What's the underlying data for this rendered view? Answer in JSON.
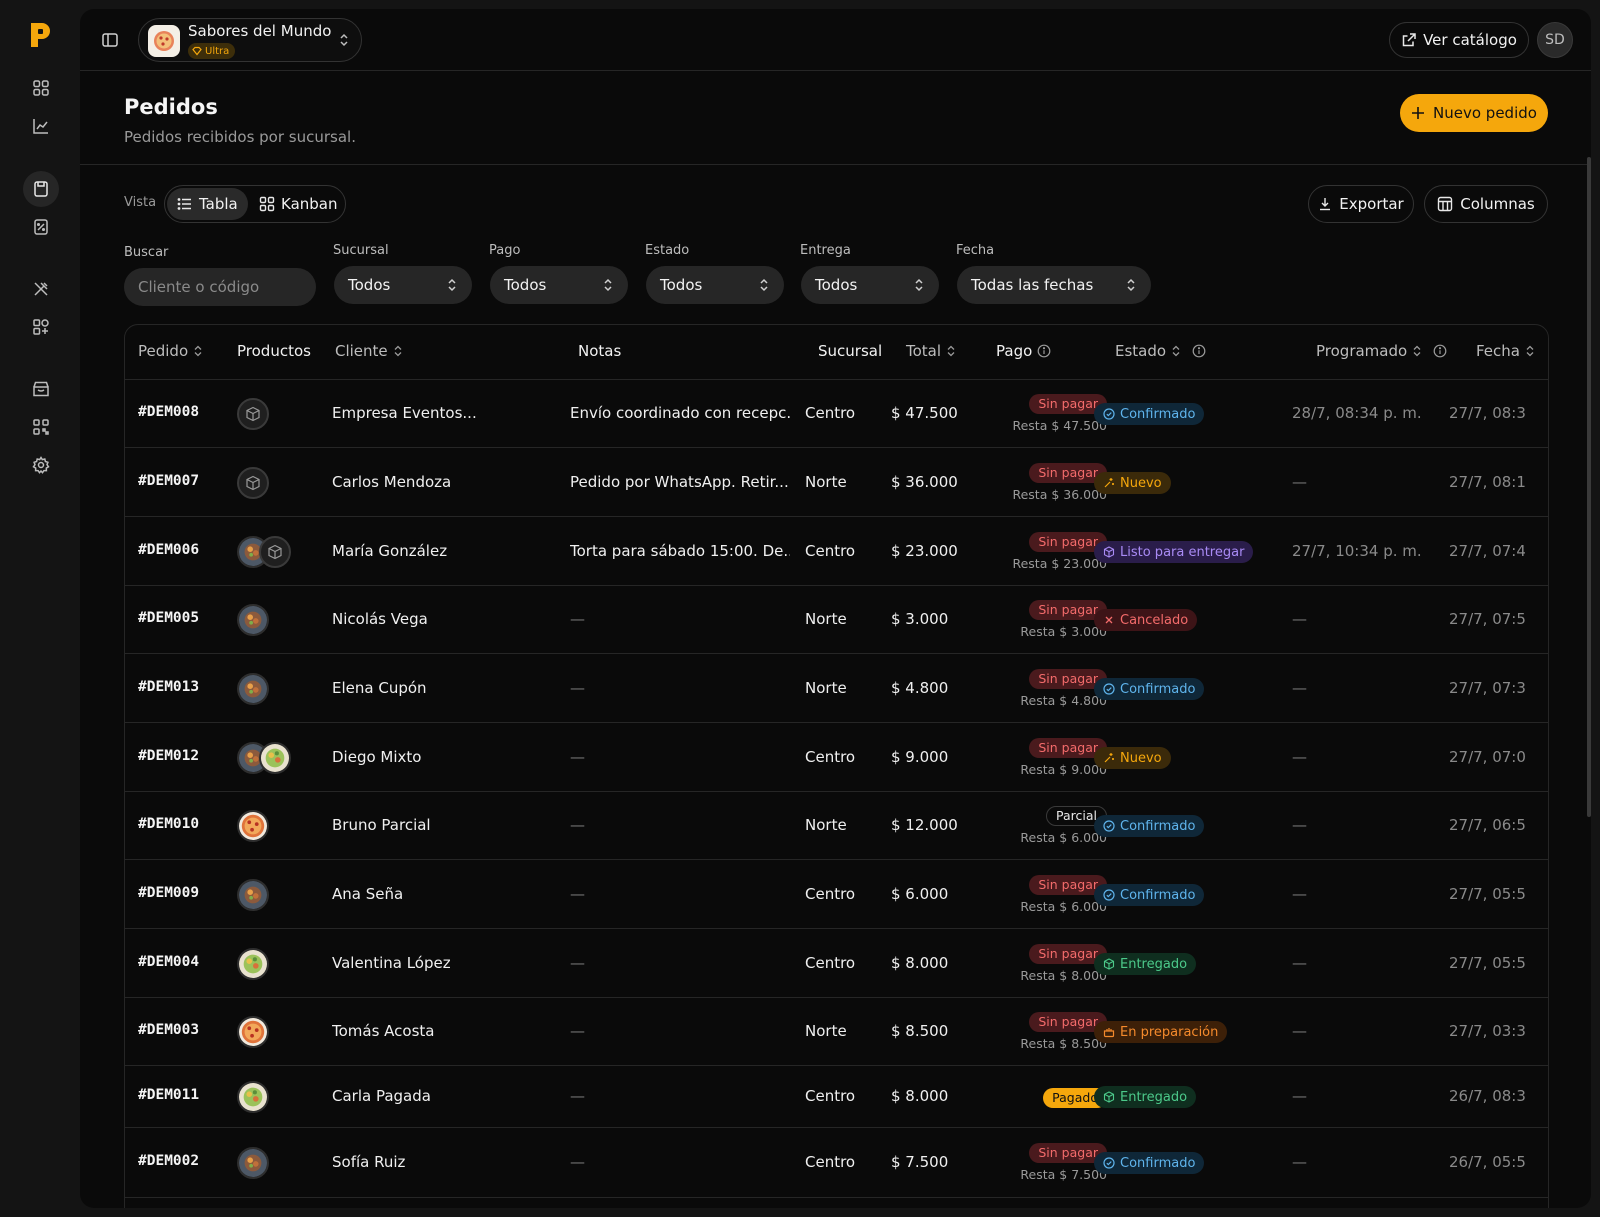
{
  "store": {
    "name": "Sabores del Mundo",
    "plan": "Ultra"
  },
  "topbar": {
    "catalog_label": "Ver catálogo",
    "avatar_initials": "SD"
  },
  "header": {
    "title": "Pedidos",
    "subtitle": "Pedidos recibidos por sucursal.",
    "new_order_label": "Nuevo pedido"
  },
  "view": {
    "label": "Vista",
    "options": [
      "Tabla",
      "Kanban"
    ],
    "selected": "Tabla"
  },
  "actions": {
    "export_label": "Exportar",
    "columns_label": "Columnas"
  },
  "filters": {
    "search": {
      "label": "Buscar",
      "placeholder": "Cliente o código"
    },
    "sucursal": {
      "label": "Sucursal",
      "value": "Todos"
    },
    "pago": {
      "label": "Pago",
      "value": "Todos"
    },
    "estado": {
      "label": "Estado",
      "value": "Todos"
    },
    "entrega": {
      "label": "Entrega",
      "value": "Todos"
    },
    "fecha": {
      "label": "Fecha",
      "value": "Todas las fechas"
    }
  },
  "table": {
    "columns": [
      "Pedido",
      "Productos",
      "Cliente",
      "Notas",
      "Sucursal",
      "Total",
      "Pago",
      "Estado",
      "Programado",
      "Fecha"
    ],
    "rows": [
      {
        "id": "#DEM008",
        "products": [
          "box"
        ],
        "client": "Empresa Eventos...",
        "notes": "Envío coordinado con recepc...",
        "branch": "Centro",
        "total": "$ 47.500",
        "pay": "Sin pagar",
        "pay_kind": "sinpagar",
        "rest": "Resta $ 47.500",
        "status": "Confirmado",
        "status_kind": "confirmado",
        "scheduled": "28/7, 08:34 p. m.",
        "date": "27/7, 08:3"
      },
      {
        "id": "#DEM007",
        "products": [
          "box"
        ],
        "client": "Carlos Mendoza",
        "notes": "Pedido por WhatsApp. Retir...",
        "branch": "Norte",
        "total": "$ 36.000",
        "pay": "Sin pagar",
        "pay_kind": "sinpagar",
        "rest": "Resta $ 36.000",
        "status": "Nuevo",
        "status_kind": "nuevo",
        "scheduled": "—",
        "date": "27/7, 08:1"
      },
      {
        "id": "#DEM006",
        "products": [
          "bowl",
          "box"
        ],
        "client": "María González",
        "notes": "Torta para sábado 15:00. De...",
        "branch": "Centro",
        "total": "$ 23.000",
        "pay": "Sin pagar",
        "pay_kind": "sinpagar",
        "rest": "Resta $ 23.000",
        "status": "Listo para entregar",
        "status_kind": "listo",
        "scheduled": "27/7, 10:34 p. m.",
        "date": "27/7, 07:4"
      },
      {
        "id": "#DEM005",
        "products": [
          "bowl"
        ],
        "client": "Nicolás Vega",
        "notes": "—",
        "branch": "Norte",
        "total": "$ 3.000",
        "pay": "Sin pagar",
        "pay_kind": "sinpagar",
        "rest": "Resta $ 3.000",
        "status": "Cancelado",
        "status_kind": "cancelado",
        "scheduled": "—",
        "date": "27/7, 07:5"
      },
      {
        "id": "#DEM013",
        "products": [
          "bowl"
        ],
        "client": "Elena Cupón",
        "notes": "—",
        "branch": "Norte",
        "total": "$ 4.800",
        "pay": "Sin pagar",
        "pay_kind": "sinpagar",
        "rest": "Resta $ 4.800",
        "status": "Confirmado",
        "status_kind": "confirmado",
        "scheduled": "—",
        "date": "27/7, 07:3"
      },
      {
        "id": "#DEM012",
        "products": [
          "bowl",
          "salad"
        ],
        "client": "Diego Mixto",
        "notes": "—",
        "branch": "Centro",
        "total": "$ 9.000",
        "pay": "Sin pagar",
        "pay_kind": "sinpagar",
        "rest": "Resta $ 9.000",
        "status": "Nuevo",
        "status_kind": "nuevo",
        "scheduled": "—",
        "date": "27/7, 07:0"
      },
      {
        "id": "#DEM010",
        "products": [
          "pizza"
        ],
        "client": "Bruno Parcial",
        "notes": "—",
        "branch": "Norte",
        "total": "$ 12.000",
        "pay": "Parcial",
        "pay_kind": "parcial",
        "rest": "Resta $ 6.000",
        "status": "Confirmado",
        "status_kind": "confirmado",
        "scheduled": "—",
        "date": "27/7, 06:5"
      },
      {
        "id": "#DEM009",
        "products": [
          "bowl"
        ],
        "client": "Ana Seña",
        "notes": "—",
        "branch": "Centro",
        "total": "$ 6.000",
        "pay": "Sin pagar",
        "pay_kind": "sinpagar",
        "rest": "Resta $ 6.000",
        "status": "Confirmado",
        "status_kind": "confirmado",
        "scheduled": "—",
        "date": "27/7, 05:5"
      },
      {
        "id": "#DEM004",
        "products": [
          "salad"
        ],
        "client": "Valentina López",
        "notes": "—",
        "branch": "Centro",
        "total": "$ 8.000",
        "pay": "Sin pagar",
        "pay_kind": "sinpagar",
        "rest": "Resta $ 8.000",
        "status": "Entregado",
        "status_kind": "entregado",
        "scheduled": "—",
        "date": "27/7, 05:5"
      },
      {
        "id": "#DEM003",
        "products": [
          "pizza"
        ],
        "client": "Tomás Acosta",
        "notes": "—",
        "branch": "Norte",
        "total": "$ 8.500",
        "pay": "Sin pagar",
        "pay_kind": "sinpagar",
        "rest": "Resta $ 8.500",
        "status": "En preparación",
        "status_kind": "preparacion",
        "scheduled": "—",
        "date": "27/7, 03:3"
      },
      {
        "id": "#DEM011",
        "products": [
          "salad"
        ],
        "client": "Carla Pagada",
        "notes": "—",
        "branch": "Centro",
        "total": "$ 8.000",
        "pay": "Pagado",
        "pay_kind": "pagado",
        "rest": "",
        "status": "Entregado",
        "status_kind": "entregado",
        "scheduled": "—",
        "date": "26/7, 08:3"
      },
      {
        "id": "#DEM002",
        "products": [
          "bowl"
        ],
        "client": "Sofía Ruiz",
        "notes": "—",
        "branch": "Centro",
        "total": "$ 7.500",
        "pay": "Sin pagar",
        "pay_kind": "sinpagar",
        "rest": "Resta $ 7.500",
        "status": "Confirmado",
        "status_kind": "confirmado",
        "scheduled": "—",
        "date": "26/7, 05:5"
      }
    ]
  },
  "colors": {
    "accent": "#f5a70c",
    "panel": "#0a0a0a",
    "border": "#262626"
  }
}
